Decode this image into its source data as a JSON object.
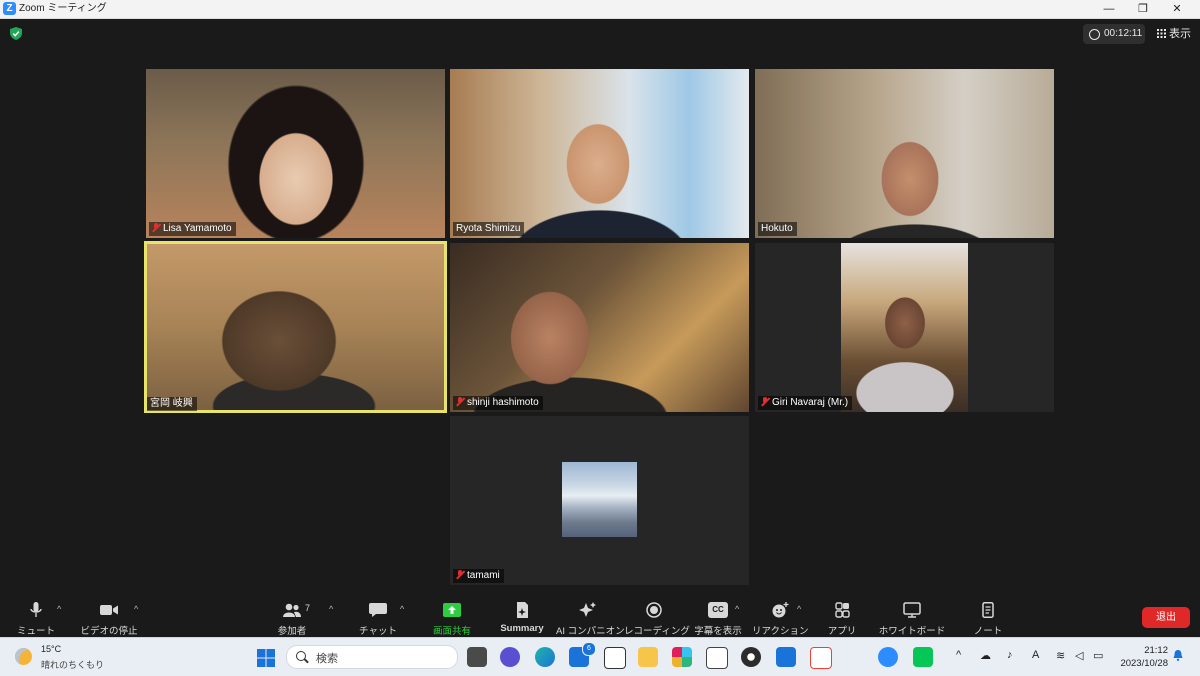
{
  "window": {
    "title": "Zoom ミーティング",
    "logo_letter": "Z"
  },
  "meeting": {
    "timer": "00:12:11",
    "view_label": "表示"
  },
  "participants": [
    {
      "name": "Lisa Yamamoto",
      "muted": true
    },
    {
      "name": "Ryota Shimizu",
      "muted": false
    },
    {
      "name": "Hokuto",
      "muted": false
    },
    {
      "name": "宮岡 岐興",
      "muted": false,
      "active_speaker": true
    },
    {
      "name": "shinji hashimoto",
      "muted": true
    },
    {
      "name": "Giri Navaraj (Mr.)",
      "muted": true
    },
    {
      "name": "tamami",
      "muted": true
    }
  ],
  "toolbar": {
    "mute": "ミュート",
    "video": "ビデオの停止",
    "participants": "参加者",
    "participants_count": "7",
    "chat": "チャット",
    "share": "画面共有",
    "summary": "Summary",
    "ai": "AI コンパニオン",
    "record": "レコーディング",
    "captions": "字幕を表示",
    "captions_icon": "CC",
    "reactions": "リアクション",
    "apps": "アプリ",
    "whiteboard": "ホワイトボード",
    "notes": "ノート",
    "exit": "退出"
  },
  "taskbar": {
    "temperature": "15°C",
    "weather": "晴れのちくもり",
    "search_placeholder": "検索",
    "mail_badge": "6",
    "time": "21:12",
    "date": "2023/10/28",
    "ime": "A"
  },
  "colors": {
    "accent": "#2d8cff",
    "active_speaker": "#e8e36a",
    "exit": "#e02828",
    "share": "#2ecc40",
    "muted": "#e02f2f"
  }
}
